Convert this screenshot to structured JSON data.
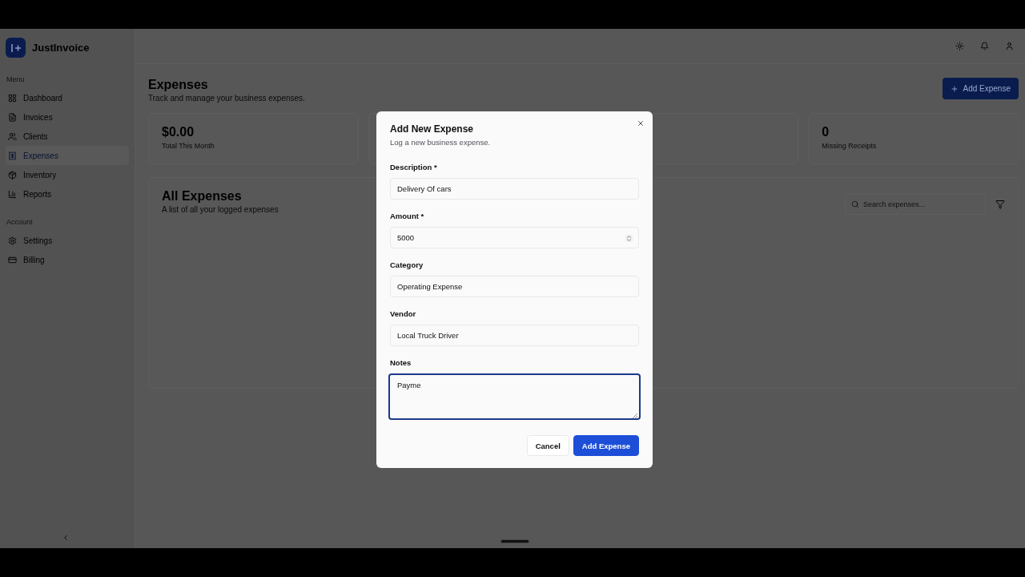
{
  "app": {
    "name": "JustInvoice"
  },
  "sidebar": {
    "sections": [
      {
        "title": "Menu",
        "items": [
          {
            "label": "Dashboard",
            "selected": false
          },
          {
            "label": "Invoices",
            "selected": false
          },
          {
            "label": "Clients",
            "selected": false
          },
          {
            "label": "Expenses",
            "selected": true
          },
          {
            "label": "Inventory",
            "selected": false
          },
          {
            "label": "Reports",
            "selected": false
          }
        ]
      },
      {
        "title": "Account",
        "items": [
          {
            "label": "Settings",
            "selected": false
          },
          {
            "label": "Billing",
            "selected": false
          }
        ]
      }
    ]
  },
  "page": {
    "title": "Expenses",
    "subtitle": "Track and manage your business expenses.",
    "add_button": "Add Expense"
  },
  "stats": [
    {
      "value": "$0.00",
      "label": "Total This Month"
    },
    {
      "value": "0",
      "label": "Missing Receipts"
    }
  ],
  "list": {
    "title": "All Expenses",
    "subtitle": "A list of all your logged expenses",
    "search": {
      "placeholder": "Search expenses..."
    }
  },
  "dialog": {
    "title": "Add New Expense",
    "subtitle": "Log a new business expense.",
    "fields": [
      {
        "label": "Description *",
        "kind": "text",
        "value": "Delivery Of cars",
        "focused": false
      },
      {
        "label": "Amount *",
        "kind": "number",
        "value": "5000",
        "focused": false
      },
      {
        "label": "Category",
        "kind": "text",
        "value": "Operating Expense",
        "focused": false
      },
      {
        "label": "Vendor",
        "kind": "text",
        "value": "Local Truck Driver",
        "focused": false
      },
      {
        "label": "Notes",
        "kind": "textarea",
        "value": "Payme",
        "focused": true
      }
    ],
    "buttons": [
      {
        "label": "Cancel",
        "kind": "secondary"
      },
      {
        "label": "Add Expense",
        "kind": "primary"
      }
    ]
  }
}
